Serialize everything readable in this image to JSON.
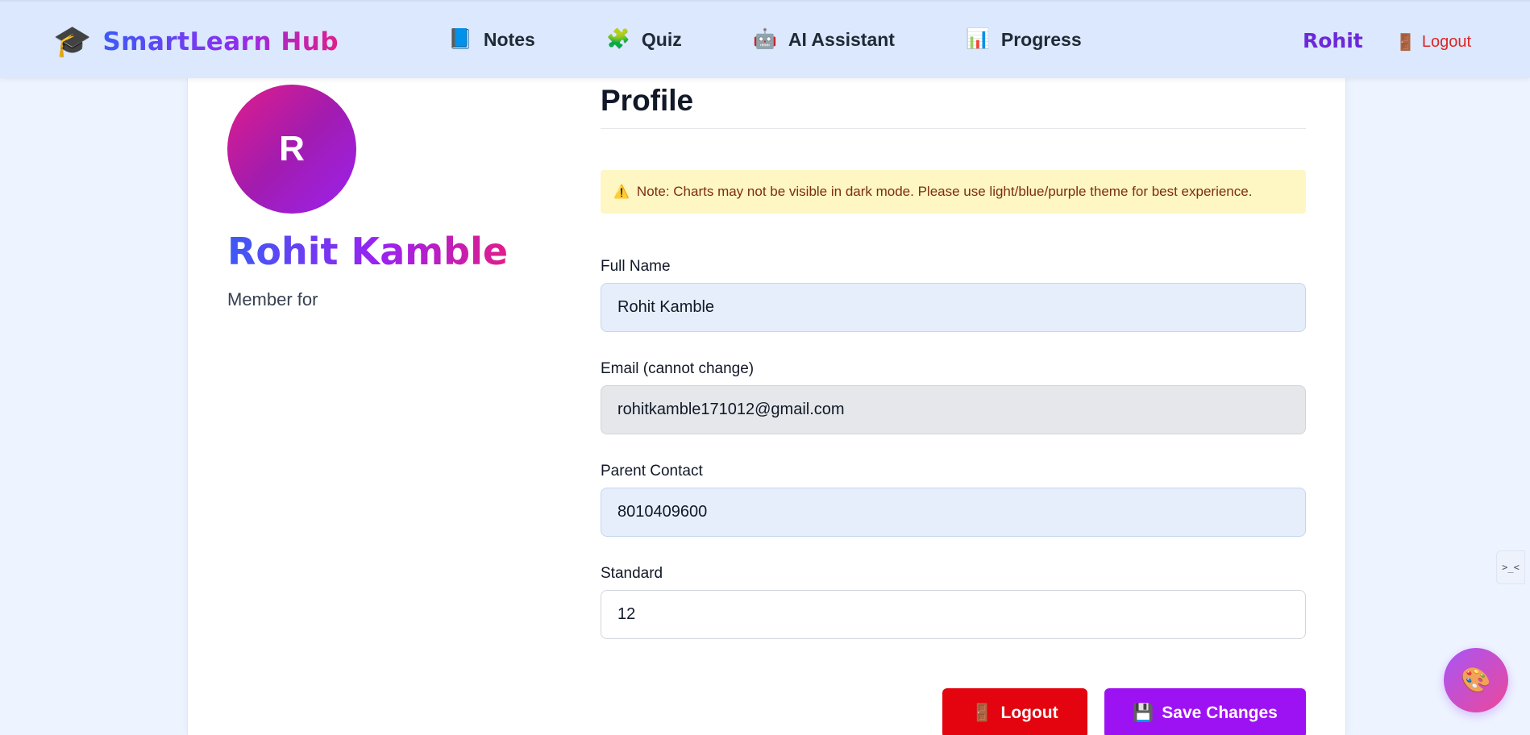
{
  "header": {
    "brand_icon": "🎓",
    "brand": "SmartLearn Hub",
    "nav": [
      {
        "icon": "📘",
        "icon_name": "notebook-icon",
        "label": "Notes"
      },
      {
        "icon": "🧩",
        "icon_name": "puzzle-icon",
        "label": "Quiz"
      },
      {
        "icon": "🤖",
        "icon_name": "robot-icon",
        "label": "AI Assistant"
      },
      {
        "icon": "📊",
        "icon_name": "chart-icon",
        "label": "Progress"
      }
    ],
    "user": "Rohit",
    "logout_icon": "🚪",
    "logout": "Logout"
  },
  "profile": {
    "avatar_initial": "R",
    "full_name": "Rohit Kamble",
    "member_for": "Member for",
    "title": "Profile",
    "note_icon": "⚠️",
    "note": "Note: Charts may not be visible in dark mode. Please use light/blue/purple theme for best experience.",
    "fields": {
      "full_name_label": "Full Name",
      "full_name_value": "Rohit Kamble",
      "email_label": "Email (cannot change)",
      "email_value": "rohitkamble171012@gmail.com",
      "parent_label": "Parent Contact",
      "parent_value": "8010409600",
      "standard_label": "Standard",
      "standard_value": "12"
    },
    "logout_button": "Logout",
    "logout_button_icon": "🚪",
    "save_button": "Save Changes",
    "save_button_icon": "💾"
  },
  "widgets": {
    "side_tab": ">_<",
    "theme_icon": "🎨"
  },
  "colors": {
    "accent_purple": "#9d12f2",
    "danger_red": "#e3040f",
    "header_bg": "#dbe8fd",
    "note_bg": "#fef6c3"
  }
}
